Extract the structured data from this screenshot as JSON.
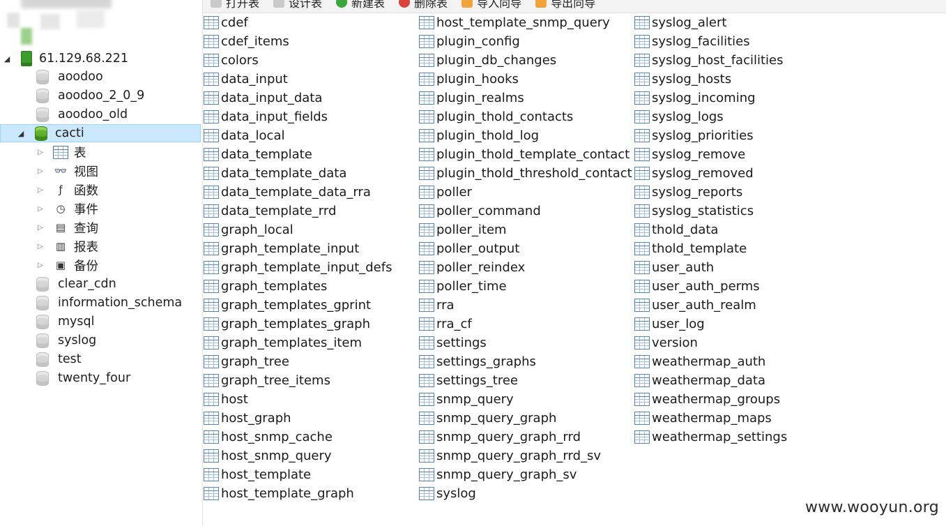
{
  "toolbar": {
    "buttons": [
      {
        "label": "打开表",
        "icon": "open-table-icon"
      },
      {
        "label": "设计表",
        "icon": "design-table-icon"
      },
      {
        "label": "新建表",
        "icon": "new-table-icon"
      },
      {
        "label": "删除表",
        "icon": "delete-table-icon"
      },
      {
        "label": "导入向导",
        "icon": "import-wizard-icon"
      },
      {
        "label": "导出向导",
        "icon": "export-wizard-icon"
      }
    ]
  },
  "tree": {
    "connection": "61.129.68.221",
    "databases_before": [
      "aoodoo",
      "aoodoo_2_0_9",
      "aoodoo_old"
    ],
    "selected_db": "cacti",
    "children": [
      {
        "label": "表",
        "icon": "table-icon"
      },
      {
        "label": "视图",
        "icon": "view-glasses-icon"
      },
      {
        "label": "函数",
        "icon": "function-icon"
      },
      {
        "label": "事件",
        "icon": "event-clock-icon"
      },
      {
        "label": "查询",
        "icon": "query-icon"
      },
      {
        "label": "报表",
        "icon": "report-icon"
      },
      {
        "label": "备份",
        "icon": "backup-icon"
      }
    ],
    "databases_after": [
      "clear_cdn",
      "information_schema",
      "mysql",
      "syslog",
      "test",
      "twenty_four"
    ]
  },
  "tables": {
    "col1": [
      "cdef",
      "cdef_items",
      "colors",
      "data_input",
      "data_input_data",
      "data_input_fields",
      "data_local",
      "data_template",
      "data_template_data",
      "data_template_data_rra",
      "data_template_rrd",
      "graph_local",
      "graph_template_input",
      "graph_template_input_defs",
      "graph_templates",
      "graph_templates_gprint",
      "graph_templates_graph",
      "graph_templates_item",
      "graph_tree",
      "graph_tree_items",
      "host",
      "host_graph",
      "host_snmp_cache",
      "host_snmp_query",
      "host_template",
      "host_template_graph"
    ],
    "col2": [
      "host_template_snmp_query",
      "plugin_config",
      "plugin_db_changes",
      "plugin_hooks",
      "plugin_realms",
      "plugin_thold_contacts",
      "plugin_thold_log",
      "plugin_thold_template_contact",
      "plugin_thold_threshold_contact",
      "poller",
      "poller_command",
      "poller_item",
      "poller_output",
      "poller_reindex",
      "poller_time",
      "rra",
      "rra_cf",
      "settings",
      "settings_graphs",
      "settings_tree",
      "snmp_query",
      "snmp_query_graph",
      "snmp_query_graph_rrd",
      "snmp_query_graph_rrd_sv",
      "snmp_query_graph_sv",
      "syslog"
    ],
    "col3": [
      "syslog_alert",
      "syslog_facilities",
      "syslog_host_facilities",
      "syslog_hosts",
      "syslog_incoming",
      "syslog_logs",
      "syslog_priorities",
      "syslog_remove",
      "syslog_removed",
      "syslog_reports",
      "syslog_statistics",
      "thold_data",
      "thold_template",
      "user_auth",
      "user_auth_perms",
      "user_auth_realm",
      "user_log",
      "version",
      "weathermap_auth",
      "weathermap_data",
      "weathermap_groups",
      "weathermap_maps",
      "weathermap_settings"
    ]
  },
  "watermark": "www.wooyun.org"
}
